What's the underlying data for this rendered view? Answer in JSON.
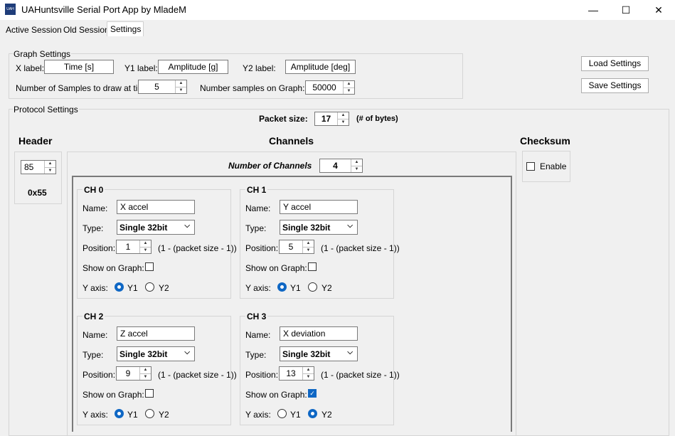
{
  "window": {
    "title": "UAHuntsville Serial Port App by MladeM",
    "icon_text": "UAH",
    "minimize_icon": "—",
    "maximize_icon": "☐",
    "close_icon": "✕"
  },
  "tabs": [
    {
      "label": "Active Session"
    },
    {
      "label": "Old Session"
    },
    {
      "label": "Settings"
    }
  ],
  "graph_settings": {
    "title": "Graph Settings",
    "x_label_caption": "X label:",
    "x_label_value": "Time [s]",
    "y1_label_caption": "Y1 label:",
    "y1_label_value": "Amplitude [g]",
    "y2_label_caption": "Y2 label:",
    "y2_label_value": "Amplitude [deg]",
    "samples_draw_caption": "Number of Samples to draw at time:",
    "samples_draw_value": "5",
    "samples_graph_caption": "Number samples on Graph:",
    "samples_graph_value": "50000"
  },
  "buttons": {
    "load_settings": "Load Settings",
    "save_settings": "Save Settings"
  },
  "protocol": {
    "title": "Protocol Settings",
    "packet_size_caption": "Packet size:",
    "packet_size_value": "17",
    "packet_size_unit": "(# of bytes)",
    "header_title": "Header",
    "header_value": "85",
    "header_hex": "0x55",
    "channels_title": "Channels",
    "num_channels_caption": "Number of Channels",
    "num_channels_value": "4",
    "checksum_title": "Checksum",
    "checksum_enable_label": "Enable"
  },
  "channel_labels": {
    "name": "Name:",
    "type": "Type:",
    "position": "Position:",
    "position_hint": "(1 - (packet size - 1))",
    "show_on_graph": "Show on Graph:",
    "y_axis": "Y axis:",
    "y1": "Y1",
    "y2": "Y2"
  },
  "channels": [
    {
      "title": "CH 0",
      "name": "X accel",
      "type": "Single 32bit",
      "position": "1",
      "show_on_graph": false,
      "y_axis": "Y1"
    },
    {
      "title": "CH 1",
      "name": "Y accel",
      "type": "Single 32bit",
      "position": "5",
      "show_on_graph": false,
      "y_axis": "Y1"
    },
    {
      "title": "CH 2",
      "name": "Z accel",
      "type": "Single 32bit",
      "position": "9",
      "show_on_graph": false,
      "y_axis": "Y1"
    },
    {
      "title": "CH 3",
      "name": "X deviation",
      "type": "Single 32bit",
      "position": "13",
      "show_on_graph": true,
      "y_axis": "Y2"
    }
  ],
  "colors": {
    "accent": "#0f67c4"
  }
}
